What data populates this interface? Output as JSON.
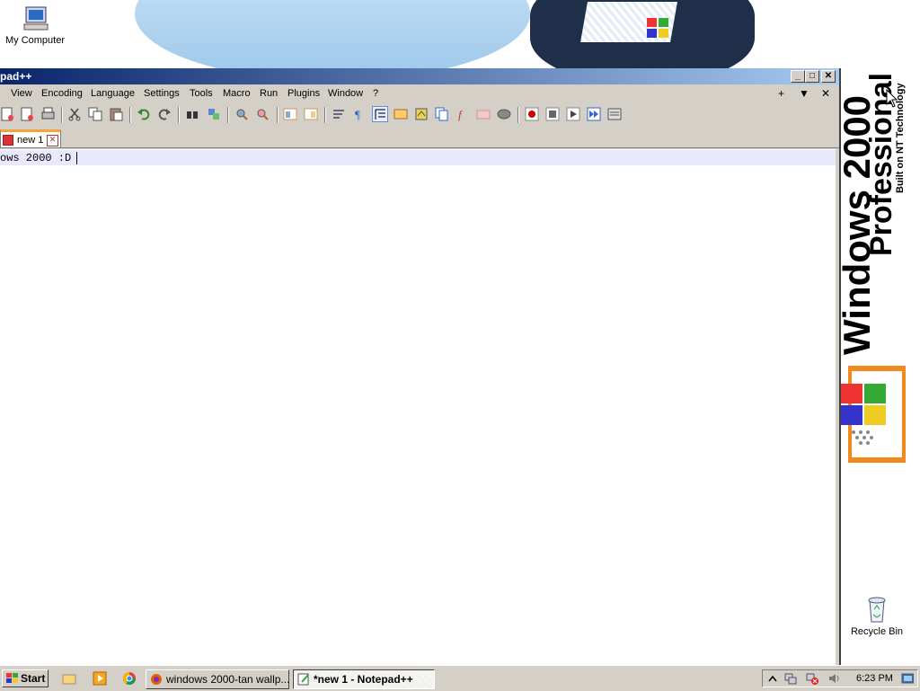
{
  "desktop": {
    "icons": [
      {
        "label": "My Computer"
      },
      {
        "label": "Recycle Bin"
      }
    ],
    "brand": {
      "windows": "Windows 2000",
      "edition": "Professional",
      "tagline": "Built on NT Technology"
    }
  },
  "window": {
    "title": "pad++",
    "menus": [
      "View",
      "Encoding",
      "Language",
      "Settings",
      "Tools",
      "Macro",
      "Run",
      "Plugins",
      "Window",
      "?"
    ],
    "menu_right": [
      "+",
      "▼",
      "✕"
    ],
    "tabs": [
      {
        "label": "new 1"
      }
    ],
    "editor_text": "ows 2000 :D"
  },
  "taskbar": {
    "start_label": "Start",
    "tasks": [
      {
        "label": "windows 2000-tan wallp..."
      },
      {
        "label": "*new 1 - Notepad++"
      }
    ],
    "clock": "6:23 PM"
  },
  "colors": {
    "titlebar_start": "#0a246a",
    "titlebar_end": "#a6caf0",
    "face": "#d4d0c8",
    "current_line": "#e8e8ff",
    "tab_accent": "#f7a23b"
  }
}
